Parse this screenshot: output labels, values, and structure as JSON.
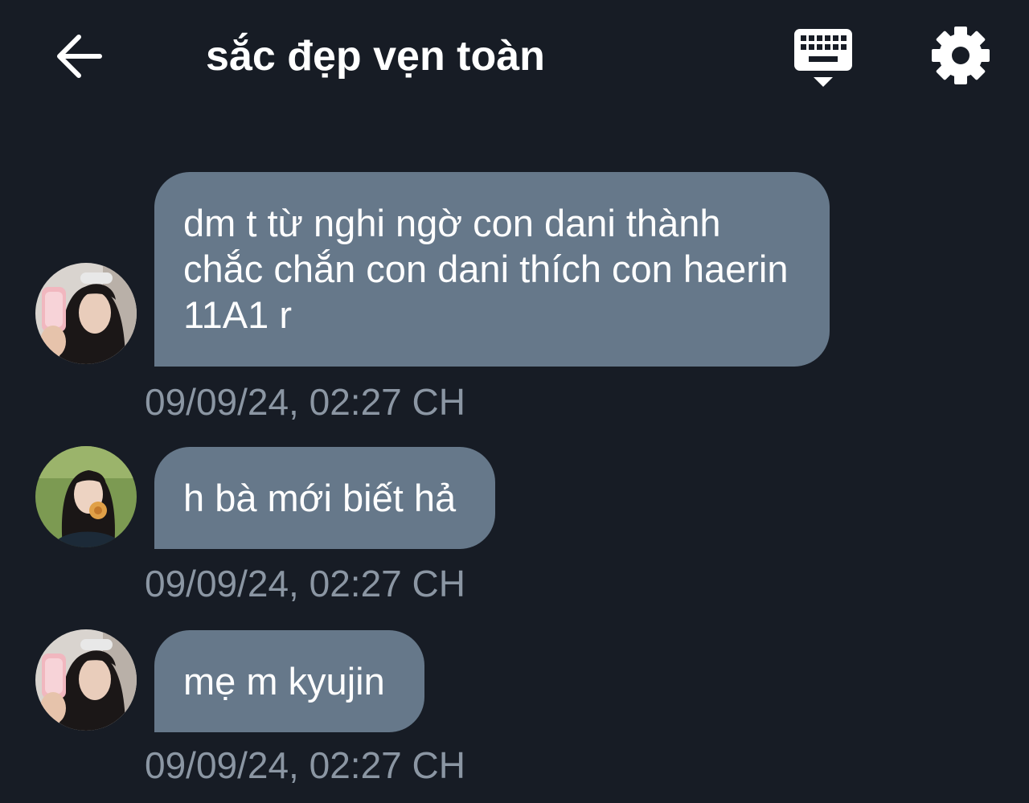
{
  "header": {
    "title": "sắc đẹp vẹn toàn",
    "back_icon": "arrow-left-icon",
    "keyboard_icon": "keyboard-hide-icon",
    "settings_icon": "gear-icon"
  },
  "messages": [
    {
      "text": "dm t từ nghi ngờ con dani thành chắc chắn con dani thích con haerin 11A1 r",
      "timestamp": "09/09/24, 02:27 CH",
      "avatar": "avatar-girl-phone-selfie"
    },
    {
      "text": "h bà mới biết hả",
      "timestamp": "09/09/24, 02:27 CH",
      "avatar": "avatar-girl-grass"
    },
    {
      "text": "mẹ m kyujin",
      "timestamp": "09/09/24, 02:27 CH",
      "avatar": "avatar-girl-phone-selfie"
    }
  ],
  "colors": {
    "background": "#171c25",
    "bubble": "#66788a",
    "timestamp": "#8b96a3",
    "text": "#ffffff"
  }
}
